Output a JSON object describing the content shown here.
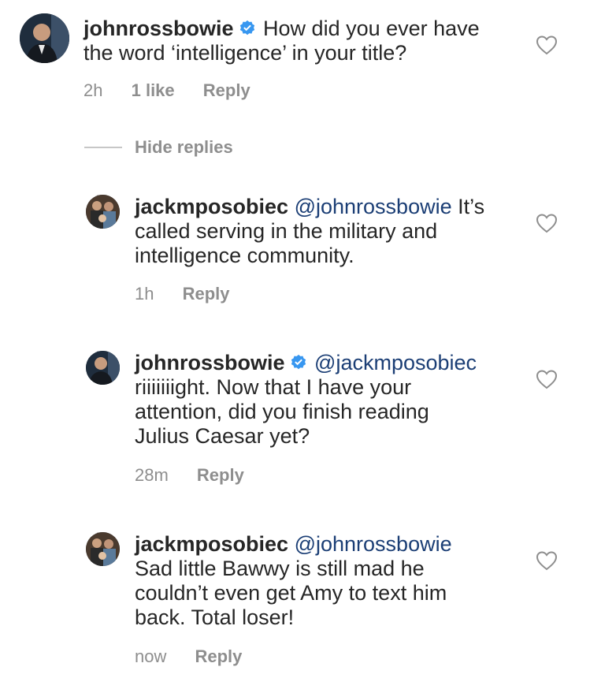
{
  "comments": [
    {
      "username": "johnrossbowie",
      "verified": true,
      "mention": "",
      "text_lines": [
        "How did you ever have",
        "the word ‘intelligence’ in your title?"
      ],
      "time": "2h",
      "likes": "1 like",
      "reply_label": "Reply"
    },
    {
      "username": "jackmposobiec",
      "verified": false,
      "mention": "@johnrossbowie",
      "text_lines": [
        "It’s",
        "called serving in the military and",
        "intelligence community."
      ],
      "time": "1h",
      "reply_label": "Reply"
    },
    {
      "username": "johnrossbowie",
      "verified": true,
      "mention": "@jackmposobiec",
      "text_lines": [
        "riiiiiiight. Now that I have your",
        "attention, did you finish reading",
        "Julius Caesar yet?"
      ],
      "time": "28m",
      "reply_label": "Reply"
    },
    {
      "username": "jackmposobiec",
      "verified": false,
      "mention": "@johnrossbowie",
      "text_lines": [
        "Sad little Bawwy is still mad he",
        "couldn’t even get Amy to text him",
        "back. Total loser!"
      ],
      "time": "now",
      "reply_label": "Reply"
    }
  ],
  "hide_replies_label": "Hide replies",
  "colors": {
    "text": "#262626",
    "meta": "#8e8e8e",
    "mention": "#1b3e75",
    "verified": "#3897f0"
  }
}
